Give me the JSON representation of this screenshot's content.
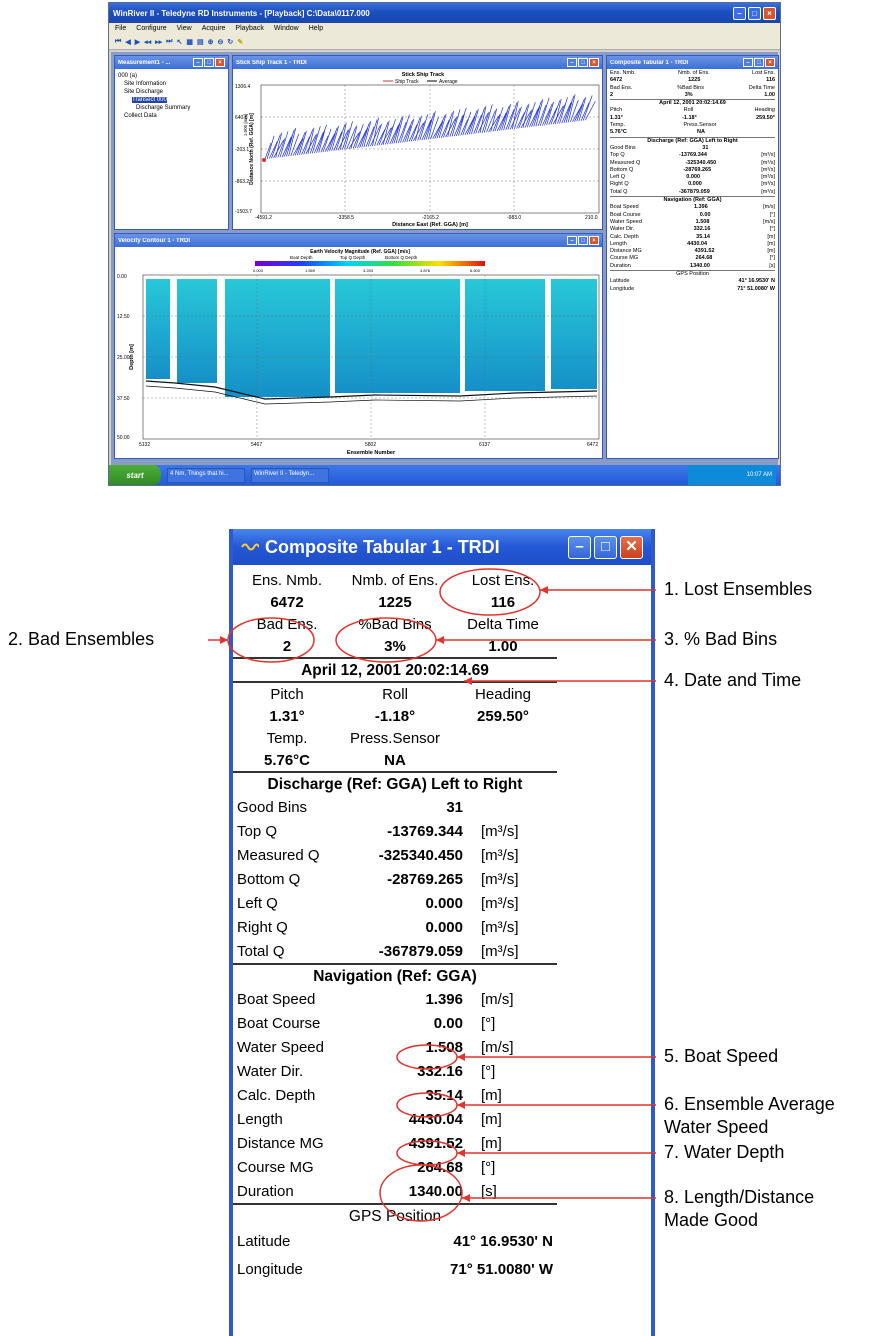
{
  "screenshot": {
    "window_title": "WinRiver II - Teledyne RD Instruments - [Playback] C:\\Data\\0117.000",
    "menu": [
      "File",
      "Configure",
      "View",
      "Acquire",
      "Playback",
      "Window",
      "Help"
    ],
    "measurement_panel": {
      "title": "Measurement1 - ...",
      "tree": [
        "000 (a)",
        "Site Information",
        "Site Discharge",
        "Transect 000",
        "Discharge Summary",
        "Collect Data"
      ]
    },
    "ship_track": {
      "title": "Stick Ship Track 1 - TRDI",
      "chart_title": "Stick Ship Track",
      "legend": [
        "Ship Track",
        "Average"
      ],
      "xlabel": "Distance East (Ref. GGA) [m]",
      "ylabel": "Distance North (Ref. GGA) [m]",
      "side_label": "1.000 [m/s]",
      "x_ticks": [
        "-4591.2",
        "-3358.5",
        "-2165.2",
        "-983.0",
        "210.0"
      ],
      "y_ticks": [
        "1306.4",
        "640.8",
        "-203.1",
        "-863.2",
        "-1503.7"
      ]
    },
    "contour": {
      "title": "Velocity Contour 1 - TRDI",
      "chart_title": "Earth Velocity Magnitude (Ref. GGA) [m/s]",
      "legend": [
        "Boat Depth",
        "Top Q Depth",
        "Bottom Q Depth"
      ],
      "scale": [
        "0.000",
        "1.569",
        "3.253",
        "4.876",
        "6.500"
      ],
      "xlabel": "Ensemble Number",
      "ylabel": "Depth [m]",
      "x_ticks": [
        "5132",
        "5467",
        "5802",
        "6137",
        "6472"
      ],
      "y_ticks": [
        "0.00",
        "12.50",
        "25.00",
        "37.50",
        "50.00"
      ]
    },
    "mini_tabular": {
      "title": "Composite Tabular 1 - TRDI",
      "rows": [
        [
          "Ens. Nmb.",
          "Nmb. of Ens.",
          "Lost Ens."
        ],
        [
          "6472",
          "1225",
          "116"
        ],
        [
          "Bad Ens.",
          "%Bad Bins",
          "Delta Time"
        ],
        [
          "2",
          "3%",
          "1.00"
        ]
      ]
    },
    "taskbar": {
      "start": "start",
      "buttons": [
        "4 Nm, Things that hi...",
        "WinRiver II - Teledyn..."
      ],
      "clock": "10:07 AM"
    }
  },
  "panel": {
    "title": "Composite Tabular 1 - TRDI",
    "head": {
      "r1": [
        "Ens. Nmb.",
        "Nmb. of Ens.",
        "Lost Ens."
      ],
      "r2": [
        "6472",
        "1225",
        "116"
      ],
      "r3": [
        "Bad Ens.",
        "%Bad Bins",
        "Delta Time"
      ],
      "r4": [
        "2",
        "3%",
        "1.00"
      ]
    },
    "datetime": "April 12, 2001  20:02:14.69",
    "attitude": {
      "labels": [
        "Pitch",
        "Roll",
        "Heading"
      ],
      "values": [
        "1.31°",
        "-1.18°",
        "259.50°"
      ],
      "labels2": [
        "Temp.",
        "Press.Sensor"
      ],
      "values2": [
        "5.76°C",
        "NA"
      ]
    },
    "discharge": {
      "heading": "Discharge (Ref: GGA) Left to Right",
      "good_bins_label": "Good Bins",
      "good_bins": "31",
      "rows": [
        {
          "k": "Top Q",
          "v": "-13769.344",
          "u": "[m³/s]"
        },
        {
          "k": "Measured Q",
          "v": "-325340.450",
          "u": "[m³/s]"
        },
        {
          "k": "Bottom Q",
          "v": "-28769.265",
          "u": "[m³/s]"
        },
        {
          "k": "Left Q",
          "v": "0.000",
          "u": "[m³/s]"
        },
        {
          "k": "Right Q",
          "v": "0.000",
          "u": "[m³/s]"
        },
        {
          "k": "Total Q",
          "v": "-367879.059",
          "u": "[m³/s]"
        }
      ]
    },
    "navigation": {
      "heading": "Navigation (Ref: GGA)",
      "rows": [
        {
          "k": "Boat Speed",
          "v": "1.396",
          "u": "[m/s]"
        },
        {
          "k": "Boat Course",
          "v": "0.00",
          "u": "[°]"
        },
        {
          "k": "Water Speed",
          "v": "1.508",
          "u": "[m/s]"
        },
        {
          "k": "Water Dir.",
          "v": "332.16",
          "u": "[°]"
        },
        {
          "k": "Calc. Depth",
          "v": "35.14",
          "u": "[m]"
        },
        {
          "k": "Length",
          "v": "4430.04",
          "u": "[m]"
        },
        {
          "k": "Distance MG",
          "v": "4391.52",
          "u": "[m]"
        },
        {
          "k": "Course MG",
          "v": "264.68",
          "u": "[°]"
        },
        {
          "k": "Duration",
          "v": "1340.00",
          "u": "[s]"
        }
      ]
    },
    "gps": {
      "heading": "GPS Position",
      "lat_label": "Latitude",
      "lat": "41° 16.9530' N",
      "lon_label": "Longitude",
      "lon": "71° 51.0080' W"
    }
  },
  "callouts": {
    "c1": "1.  Lost Ensembles",
    "c2": "2.  Bad Ensembles",
    "c3": "3.  % Bad Bins",
    "c4": "4.  Date and Time",
    "c5": "5.  Boat Speed",
    "c6a": "6.  Ensemble Average",
    "c6b": "Water Speed",
    "c7": "7.  Water Depth",
    "c8a": "8.  Length/Distance",
    "c8b": "Made Good",
    "accent": "#e0342c"
  }
}
